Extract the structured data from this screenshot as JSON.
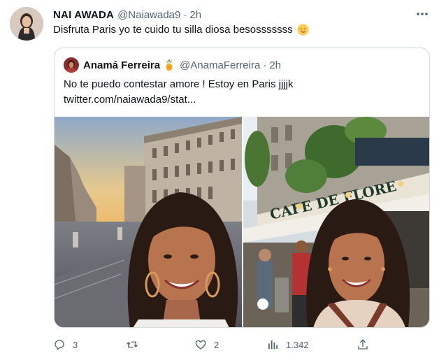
{
  "tweet": {
    "display_name": "NAI AWADA",
    "handle": "@Naiawada9",
    "separator": "·",
    "time": "2h",
    "text": "Disfruta Paris yo te cuido tu silla diosa besosssssss",
    "emoji": "relieved-face",
    "avatar_icon": "user-avatar"
  },
  "quote": {
    "display_name": "Anamá Ferreira",
    "name_emoji": "pineapple",
    "handle": "@AnamaFerreira",
    "separator": "·",
    "time": "2h",
    "text_line1": "No te puedo contestar amore ! Estoy en Paris jjjjk",
    "text_line2": "twitter.com/naiawada9/stat...",
    "photo_left": "selfie-paris-street-sunset",
    "photo_right": "selfie-cafe-de-flore",
    "sign_text": "CAFE DE FLORE"
  },
  "actions": {
    "reply_count": "3",
    "retweet_count": "",
    "like_count": "2",
    "views_count": "1.342",
    "icons": [
      "reply-icon",
      "retweet-icon",
      "like-icon",
      "views-icon",
      "share-icon"
    ]
  },
  "colors": {
    "text_primary": "#0f1419",
    "text_secondary": "#536471",
    "border": "#cfd9de"
  }
}
